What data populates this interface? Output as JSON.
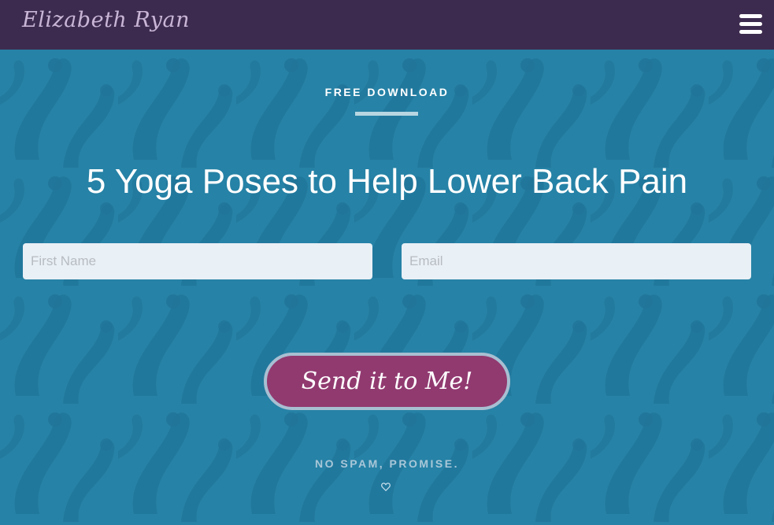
{
  "header": {
    "logo_text": "Elizabeth Ryan",
    "menu_icon": "hamburger-menu-icon"
  },
  "hero": {
    "eyebrow": "FREE DOWNLOAD",
    "headline": "5 Yoga Poses to Help Lower Back Pain",
    "first_name_placeholder": "First Name",
    "first_name_value": "",
    "email_placeholder": "Email",
    "email_value": "",
    "submit_label": "Send it to Me!",
    "note": "NO SPAM, PROMISE.",
    "note_icon": "heart-outline-icon"
  },
  "colors": {
    "topbar": "#3d2b4f",
    "hero_background": "#2682a6",
    "button": "#913a70",
    "button_border": "#a8bfd2"
  }
}
